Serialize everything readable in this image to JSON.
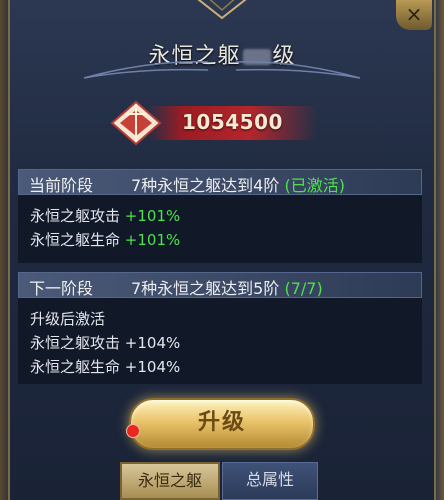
{
  "header": {
    "title_prefix": "永恒之躯",
    "title_suffix": "级",
    "close_label": "×"
  },
  "power": {
    "value": "1054500"
  },
  "current_stage": {
    "label": "当前阶段",
    "condition": "7种永恒之躯达到4阶",
    "status": "(已激活)",
    "stats": [
      {
        "name": "永恒之躯攻击",
        "value": "+101%"
      },
      {
        "name": "永恒之躯生命",
        "value": "+101%"
      }
    ]
  },
  "next_stage": {
    "label": "下一阶段",
    "condition": "7种永恒之躯达到5阶",
    "progress": "(7/7)",
    "note": "升级后激活",
    "stats": [
      {
        "name": "永恒之躯攻击",
        "value": "+104%"
      },
      {
        "name": "永恒之躯生命",
        "value": "+104%"
      }
    ]
  },
  "actions": {
    "upgrade_label": "升级"
  },
  "tabs": [
    {
      "label": "永恒之躯",
      "active": true
    },
    {
      "label": "总属性",
      "active": false
    }
  ],
  "colors": {
    "active_green": "#4ee04e",
    "power_red": "#b3262c",
    "gold": "#e9c36a"
  }
}
